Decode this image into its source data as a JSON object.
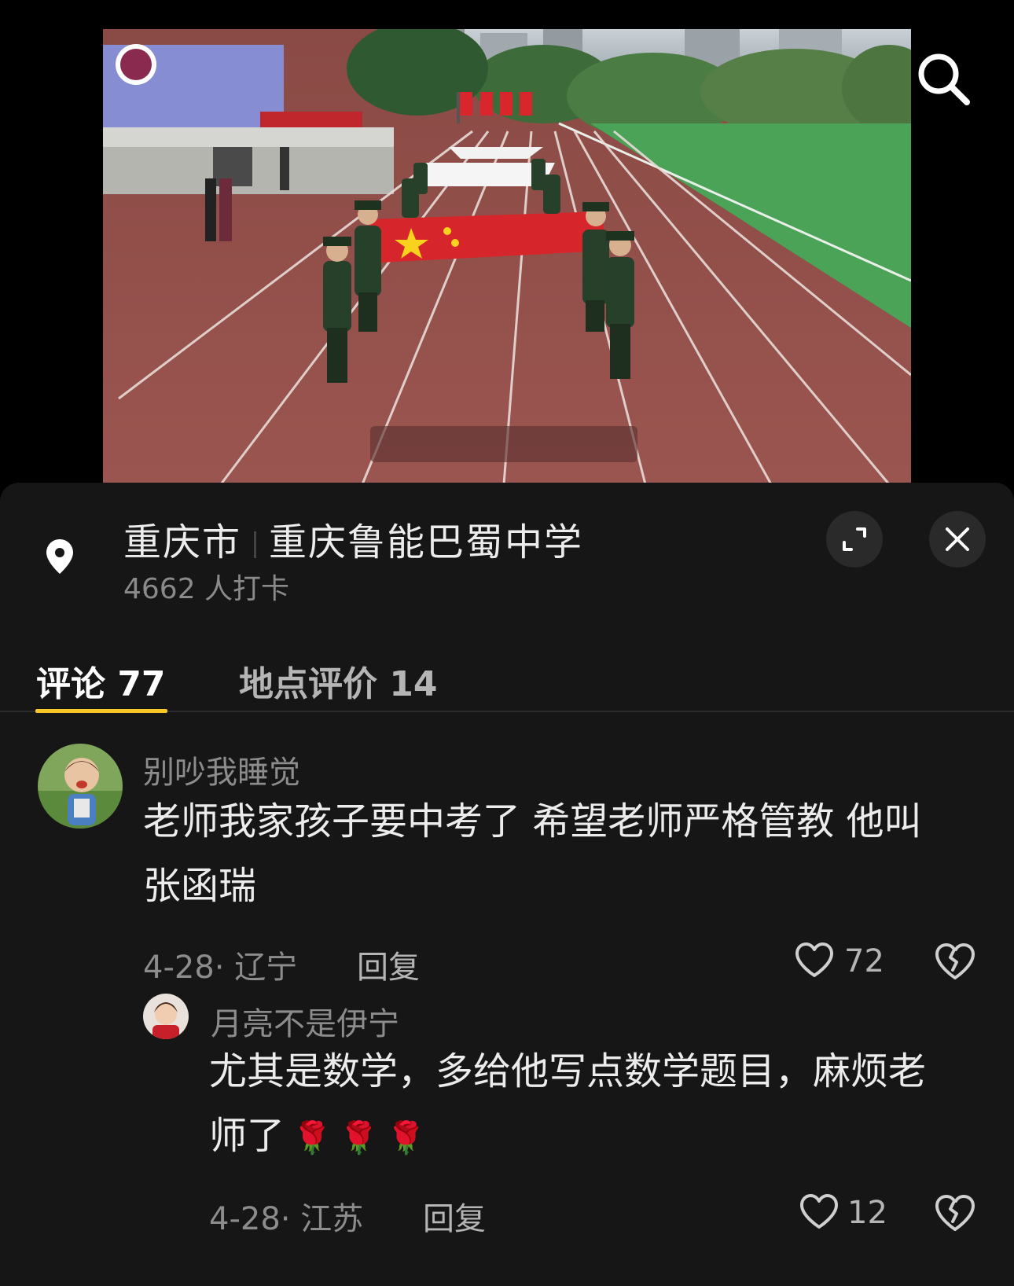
{
  "location": {
    "city": "重庆市",
    "place": "重庆鲁能巴蜀中学",
    "checkins": "4662 人打卡"
  },
  "icons": {
    "search": "search-icon",
    "pin": "location-pin-icon",
    "expand": "expand-icon",
    "close": "close-icon",
    "like": "heart-icon",
    "dislike": "broken-heart-icon"
  },
  "tabs": [
    {
      "label": "评论 77",
      "active": true
    },
    {
      "label": "地点评价 14",
      "active": false
    }
  ],
  "colors": {
    "accent": "#f7c825",
    "sheet_bg": "#161616"
  },
  "comments": [
    {
      "username": "别吵我睡觉",
      "text_line1": "老师我家孩子要中考了 希望老师严格管教 他叫",
      "text_line2": "张函瑞",
      "meta": "4-28· 辽宁",
      "reply_label": "回复",
      "likes": "72",
      "replies": [
        {
          "username": "月亮不是伊宁",
          "text_line1": "尤其是数学，多给他写点数学题目，麻烦老",
          "text_line2": "师了",
          "emoji": [
            "🌹",
            "🌹",
            "🌹"
          ],
          "meta": "4-28· 江苏",
          "reply_label": "回复",
          "likes": "12"
        }
      ]
    }
  ]
}
